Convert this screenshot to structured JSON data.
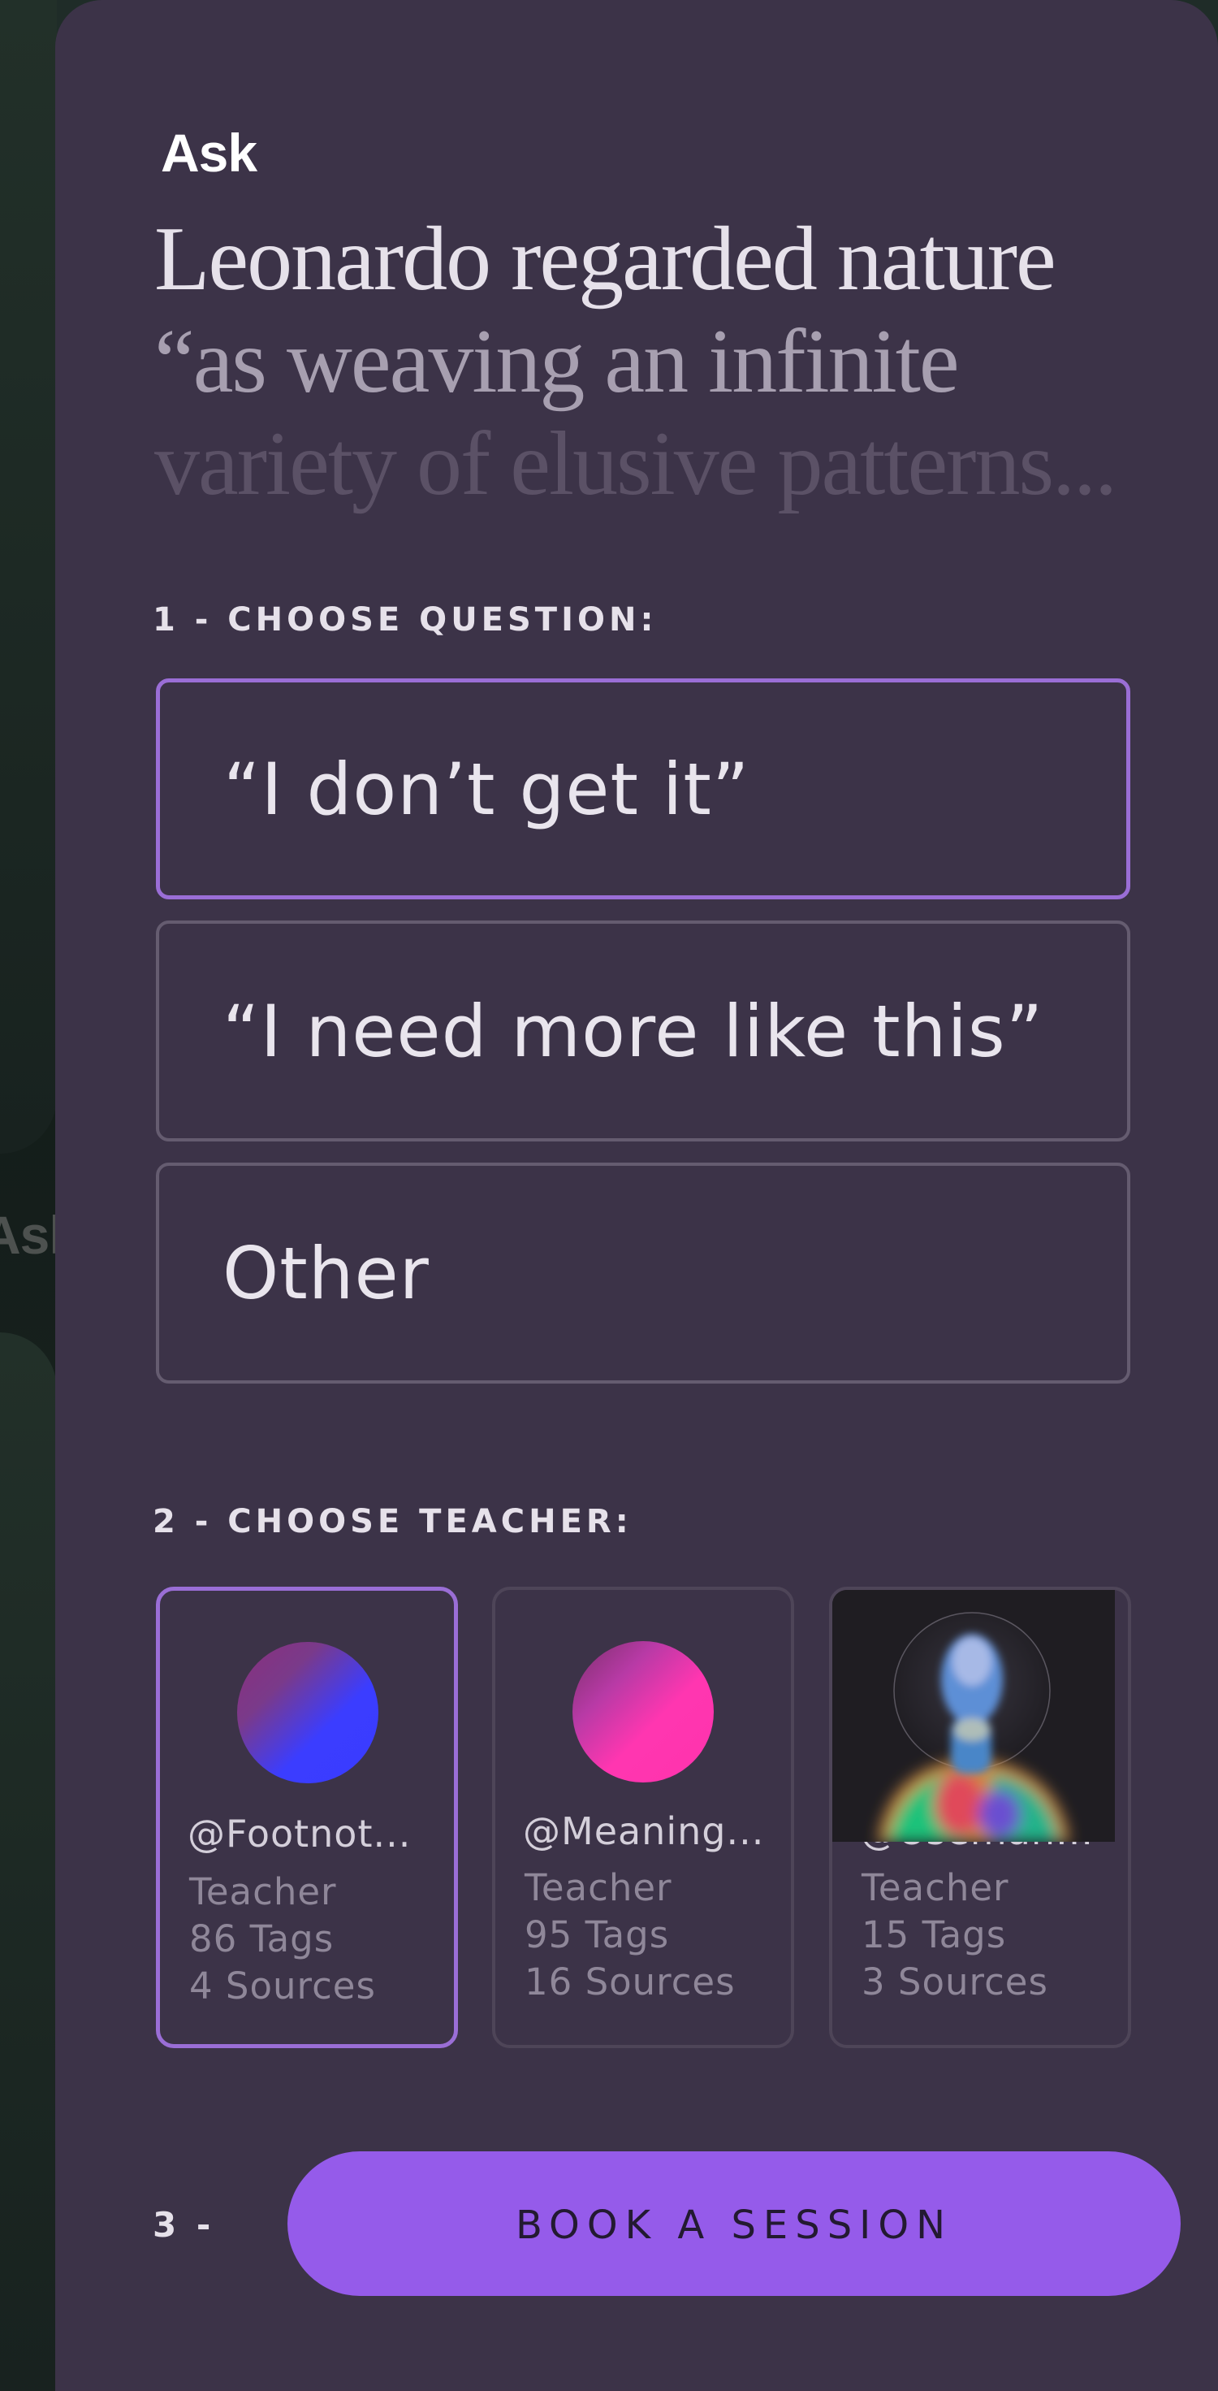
{
  "panel": {
    "title": "Ask",
    "quote": {
      "line1": "Leonardo regarded nature",
      "line2": "“as weaving an infinite",
      "line3": "variety of elusive patterns..."
    }
  },
  "background": {
    "card_label": "Ask"
  },
  "question_section": {
    "label": "1 - CHOOSE QUESTION:",
    "selected_index": 0,
    "options": [
      {
        "label": "“I don’t get it”"
      },
      {
        "label": "“I need more like this”"
      },
      {
        "label": "Other"
      }
    ]
  },
  "teacher_section": {
    "label": "2 - CHOOSE TEACHER:",
    "selected_index": 0,
    "teachers": [
      {
        "handle": "@Footnot...",
        "role": "Teacher",
        "tags": "86 Tags",
        "sources": "4 Sources",
        "avatar": "blue-magenta-gradient"
      },
      {
        "handle": "@Meaning...",
        "role": "Teacher",
        "tags": "95 Tags",
        "sources": "16 Sources",
        "avatar": "pink-gradient"
      },
      {
        "handle": "@Useman...",
        "role": "Teacher",
        "tags": "15 Tags",
        "sources": "3 Sources",
        "avatar": "thermal-portrait-photo"
      }
    ]
  },
  "book_section": {
    "step_label": "3 -",
    "button_label": "BOOK A SESSION"
  },
  "colors": {
    "panel_bg": "#3c3348",
    "accent": "#955bea",
    "selected_border": "#9a6ed6",
    "side_bg": "#1c2723"
  }
}
